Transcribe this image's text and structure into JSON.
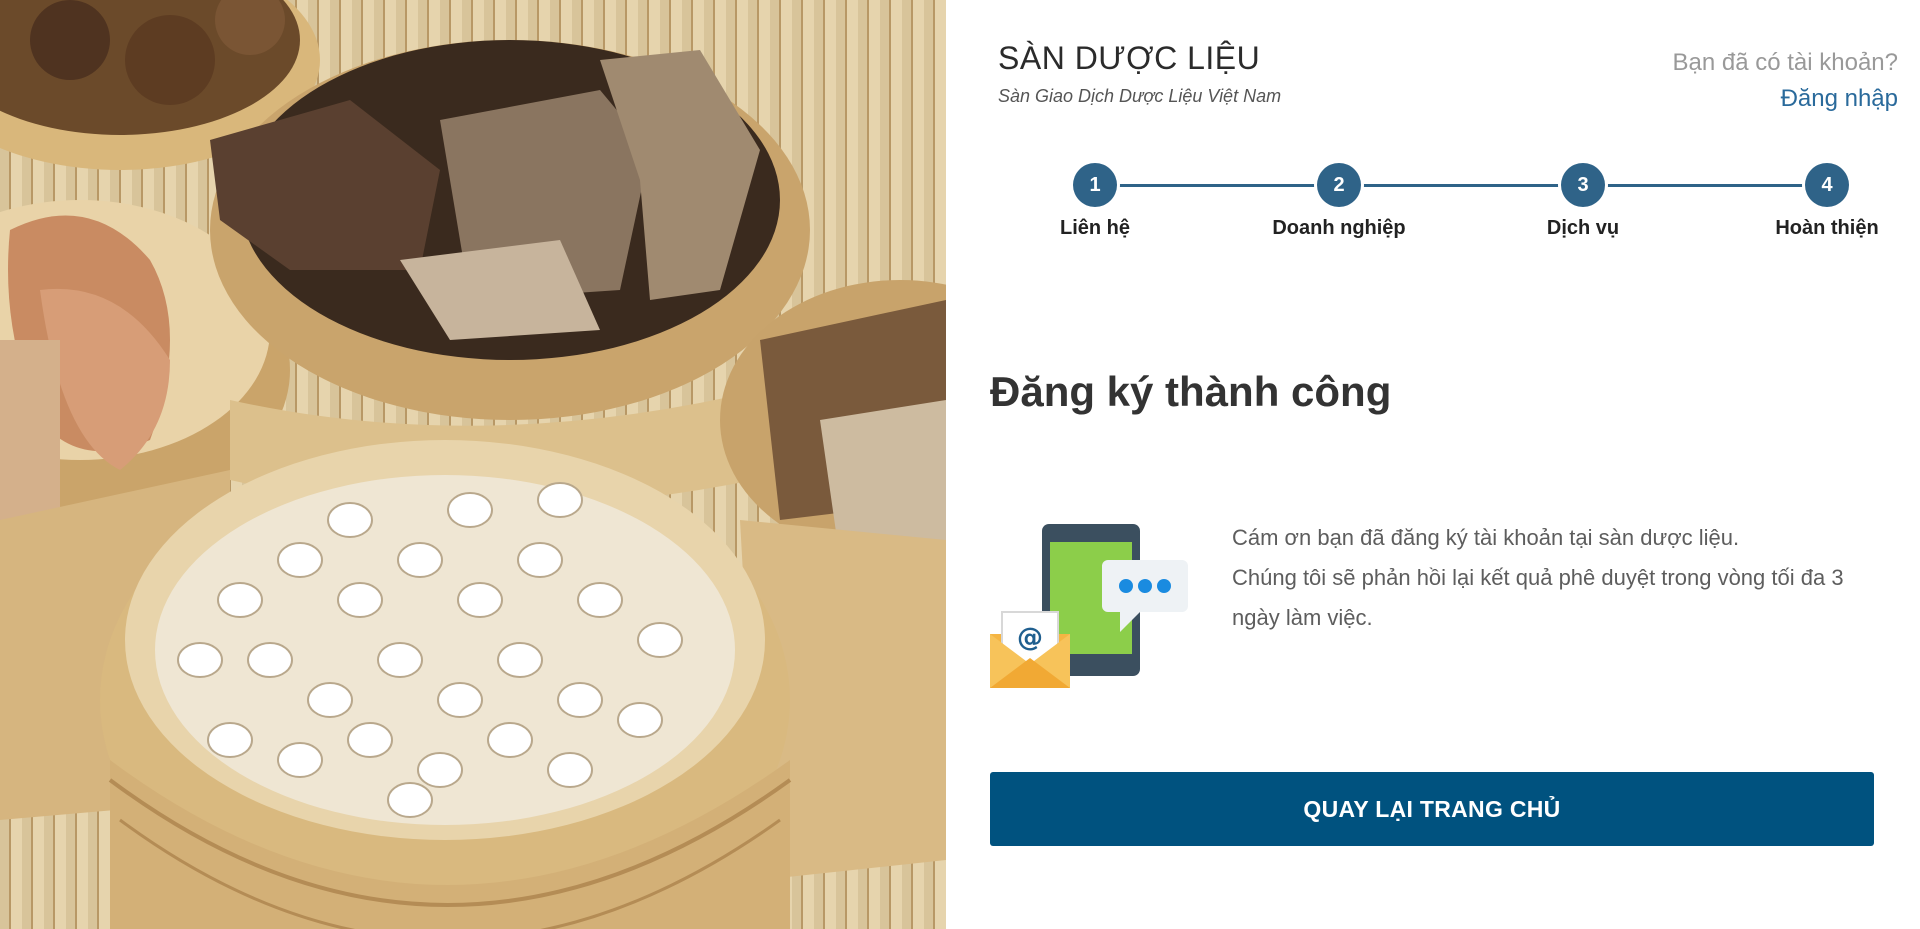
{
  "brand": {
    "title": "SÀN DƯỢC LIỆU",
    "subtitle": "Sàn Giao Dịch Dược Liệu Việt Nam"
  },
  "account": {
    "question": "Bạn đã có tài khoản?",
    "login_link": "Đăng nhập"
  },
  "stepper": {
    "steps": [
      {
        "number": "1",
        "label": "Liên hệ"
      },
      {
        "number": "2",
        "label": "Doanh nghiệp"
      },
      {
        "number": "3",
        "label": "Dịch vụ"
      },
      {
        "number": "4",
        "label": "Hoàn thiện"
      }
    ],
    "accent_color": "#2f6388"
  },
  "success": {
    "title": "Đăng ký thành công",
    "message_line1": "Cám ơn bạn đã đăng ký tài khoản tại sàn dược liệu.",
    "message_line2": "Chúng tôi sẽ phản hồi lại kết quả phê duyệt trong vòng tối đa 3 ngày làm việc.",
    "illustration_icons": [
      "phone-icon",
      "chat-bubble-icon",
      "email-envelope-icon"
    ]
  },
  "actions": {
    "home_button": "QUAY LẠI TRANG CHỦ",
    "button_color": "#00527f"
  },
  "hero_image": {
    "description_icon": "herbal-ingredients-photo"
  }
}
